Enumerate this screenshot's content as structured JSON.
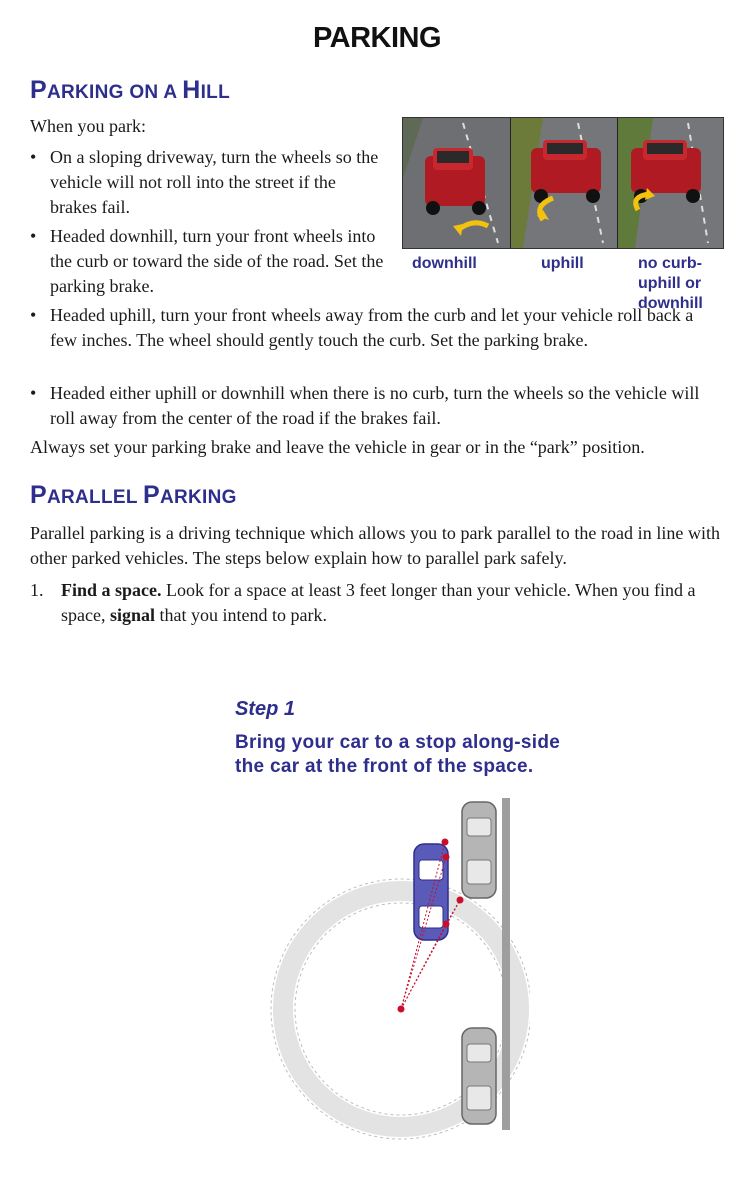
{
  "title": "PARKING",
  "hill_section": {
    "heading_parts": [
      {
        "cap": "P",
        "rest": "arking"
      },
      {
        "word": "on"
      },
      {
        "word": "a"
      },
      {
        "cap": "H",
        "rest": "ill"
      }
    ],
    "intro": "When you park:",
    "bullets": [
      "On a sloping driveway, turn the wheels so the vehicle will not roll into the street if the brakes fail.",
      "Headed downhill, turn your front wheels into the curb or toward the side of the road. Set the parking brake.",
      "Headed uphill, turn your front wheels away from the curb and let your vehicle roll back a few inches. The wheel should gently touch the curb. Set the parking brake.",
      "Headed either uphill or downhill when there is no curb, turn the wheels so the vehicle will roll away from the center of the road if the brakes fail."
    ],
    "closing": "Always set your parking brake and leave the vehicle in gear or in the “park” position.",
    "captions": {
      "downhill": "downhill",
      "uphill": "uphill",
      "no_curb_line1": "no curb-",
      "no_curb_line2": "uphill or",
      "no_curb_line3": "downhill"
    }
  },
  "parallel_section": {
    "heading_word1_cap": "P",
    "heading_word1_rest": "arallel",
    "heading_word2_cap": "P",
    "heading_word2_rest": "arking",
    "intro": "Parallel parking is a driving technique which allows you to park parallel to the road in line with other parked vehicles. The steps below explain how to parallel park safely.",
    "steps": [
      {
        "number": "1.",
        "bold_lead": "Find a space.",
        "text_a": " Look for a space at least 3 feet longer than your vehicle. When you find a space, ",
        "bold_mid": "signal",
        "text_b": " that you intend to park."
      }
    ]
  },
  "step_figure": {
    "label": "Step 1",
    "description": "Bring your car to a stop along-side the car at the front of the space."
  },
  "colors": {
    "heading": "#2e2e8c",
    "car_blue": "#5a5ab8",
    "car_gray": "#b0b0b0",
    "marker_red": "#c8102e"
  }
}
